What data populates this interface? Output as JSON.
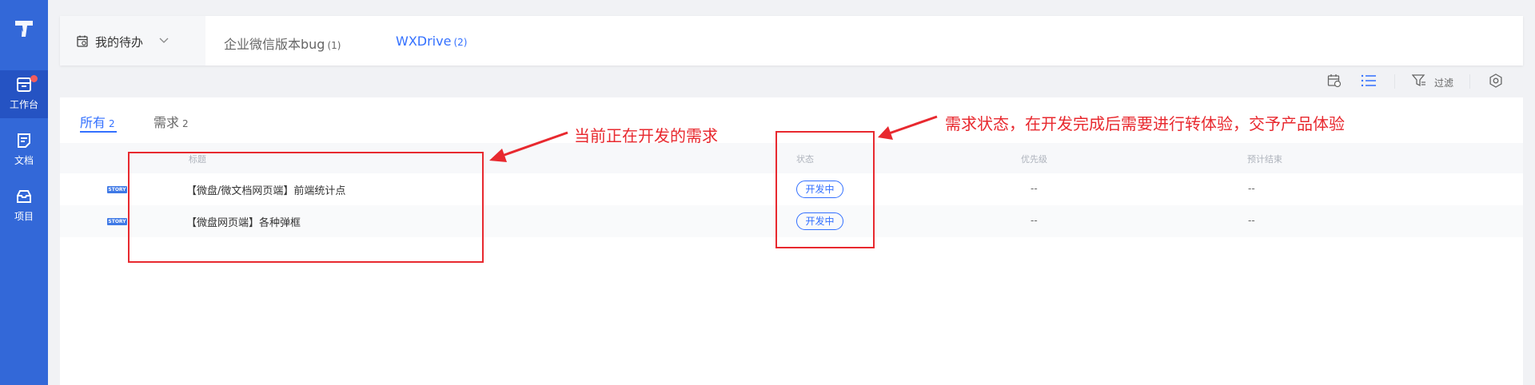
{
  "sidebar": {
    "logo": "app-logo",
    "items": [
      {
        "label": "工作台",
        "icon": "workbench-icon",
        "active": true,
        "badge": true
      },
      {
        "label": "文档",
        "icon": "document-icon",
        "active": false
      },
      {
        "label": "项目",
        "icon": "project-box-icon",
        "active": false
      }
    ]
  },
  "header": {
    "todo_label": "我的待办",
    "tabs": [
      {
        "label": "企业微信版本bug",
        "count": "(1)",
        "active": false
      },
      {
        "label": "WXDrive",
        "count": "(2)",
        "active": true
      }
    ]
  },
  "toolbar": {
    "icons": [
      "calendar-view-icon",
      "list-view-icon",
      "filter-icon",
      "settings-icon"
    ],
    "filter_label": "过滤"
  },
  "main": {
    "sub_tabs": [
      {
        "label": "所有",
        "count": "2",
        "active": true
      },
      {
        "label": "需求",
        "count": "2",
        "active": false
      }
    ],
    "columns": {
      "title": "标题",
      "status": "状态",
      "priority": "优先级",
      "due": "预计结束"
    },
    "rows": [
      {
        "tag": "STORY",
        "title": "【微盘/微文档网页端】前端统计点",
        "status": "开发中",
        "priority": "--",
        "due": "--"
      },
      {
        "tag": "STORY",
        "title": "【微盘网页端】各种弹框",
        "status": "开发中",
        "priority": "--",
        "due": "--"
      }
    ]
  },
  "annotations": {
    "left_note": "当前正在开发的需求",
    "right_note": "需求状态，在开发完成后需要进行转体验，交予产品体验",
    "color": "#e8292f"
  },
  "colors": {
    "sidebar": "#3368d8",
    "accent": "#3370ff",
    "annotation": "#e8292f"
  }
}
